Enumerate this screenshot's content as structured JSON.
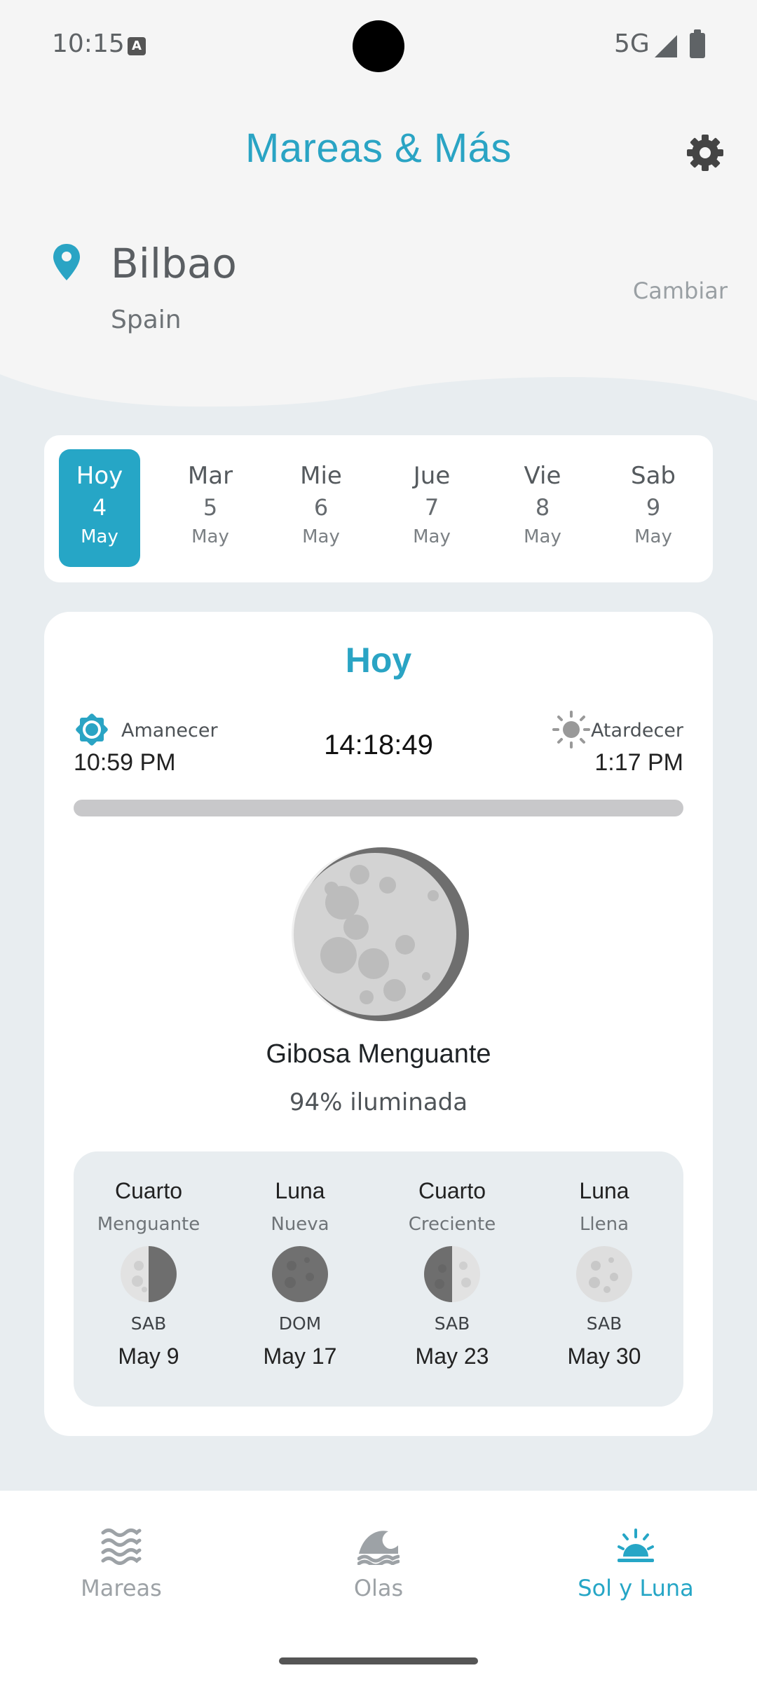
{
  "status_bar": {
    "time": "10:15",
    "network": "5G",
    "notification_badge": "A"
  },
  "header": {
    "title": "Mareas & Más"
  },
  "location": {
    "city": "Bilbao",
    "country": "Spain",
    "change_label": "Cambiar"
  },
  "days": [
    {
      "name": "Hoy",
      "date": "4",
      "month": "May",
      "selected": true
    },
    {
      "name": "Mar",
      "date": "5",
      "month": "May"
    },
    {
      "name": "Mie",
      "date": "6",
      "month": "May"
    },
    {
      "name": "Jue",
      "date": "7",
      "month": "May"
    },
    {
      "name": "Vie",
      "date": "8",
      "month": "May"
    },
    {
      "name": "Sab",
      "date": "9",
      "month": "May"
    }
  ],
  "sun_moon": {
    "title": "Hoy",
    "sunrise_label": "Amanecer",
    "sunrise_time": "10:59 PM",
    "sunset_label": "Atardecer",
    "sunset_time": "1:17 PM",
    "current_time": "14:18:49",
    "moon_phase": "Gibosa Menguante",
    "illumination": "94% iluminada"
  },
  "phases": [
    {
      "line1": "Cuarto",
      "line2": "Menguante",
      "weekday": "SAB",
      "date": "May 9"
    },
    {
      "line1": "Luna",
      "line2": "Nueva",
      "weekday": "DOM",
      "date": "May 17"
    },
    {
      "line1": "Cuarto",
      "line2": "Creciente",
      "weekday": "SAB",
      "date": "May 23"
    },
    {
      "line1": "Luna",
      "line2": "Llena",
      "weekday": "SAB",
      "date": "May 30"
    }
  ],
  "nav": [
    {
      "label": "Mareas",
      "icon": "waves-icon"
    },
    {
      "label": "Olas",
      "icon": "wave-icon"
    },
    {
      "label": "Sol y Luna",
      "icon": "sunrise-icon",
      "active": true
    }
  ],
  "colors": {
    "accent": "#26a6c6",
    "background": "#e8edf0",
    "header_bg": "#f5f5f5"
  }
}
